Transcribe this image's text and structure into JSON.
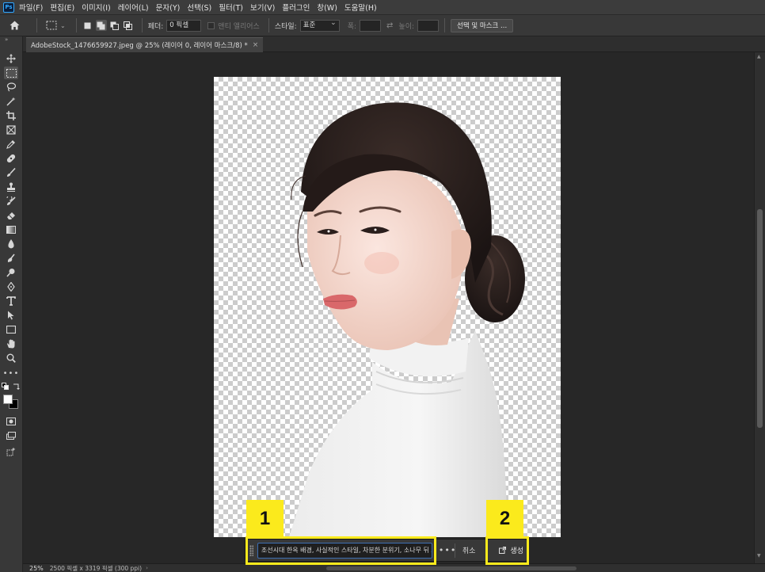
{
  "app": {
    "logo_text": "Ps"
  },
  "menu": {
    "items": [
      "파일(F)",
      "편집(E)",
      "이미지(I)",
      "레이어(L)",
      "문자(Y)",
      "선택(S)",
      "필터(T)",
      "보기(V)",
      "플러그인",
      "창(W)",
      "도움말(H)"
    ]
  },
  "options_bar": {
    "feather_label": "페더:",
    "feather_value": "0 픽셀",
    "antialias_label": "앤티 앨리어스",
    "style_label": "스타일:",
    "style_value": "표준",
    "width_label": "폭:",
    "height_label": "높이:",
    "select_mask_button": "선택 및 마스크 ..."
  },
  "document_tab": {
    "title": "AdobeStock_1476659927.jpeg @ 25% (레이어 0, 레이어 마스크/8) *",
    "close": "×"
  },
  "status_bar": {
    "zoom": "25%",
    "doc_info": "2500 픽셀 x 3319 픽셀 (300 ppi)",
    "arrow": "›"
  },
  "task_bar": {
    "prompt_text": "조선시대 한옥 배경, 사실적인 스타일, 차분한 분위기, 소나무 뒤 그",
    "more": "•••",
    "cancel_label": "취소",
    "generate_label": "생성"
  },
  "annotations": {
    "badge1": "1",
    "badge2": "2",
    "highlight_color": "#fbea1c"
  },
  "colors": {
    "foreground": "#ffffff",
    "background": "#000000",
    "accent_blue": "#3d6fb3"
  },
  "tools": [
    "move-icon",
    "marquee-icon",
    "lasso-icon",
    "magic-wand-icon",
    "crop-icon",
    "frame-icon",
    "eyedropper-icon",
    "healing-brush-icon",
    "brush-icon",
    "stamp-icon",
    "history-brush-icon",
    "eraser-icon",
    "gradient-icon",
    "blur-icon",
    "smudge-icon",
    "dodge-icon",
    "pen-icon",
    "type-icon",
    "path-select-icon",
    "rectangle-icon",
    "hand-icon",
    "zoom-icon",
    "more-tools-icon"
  ]
}
